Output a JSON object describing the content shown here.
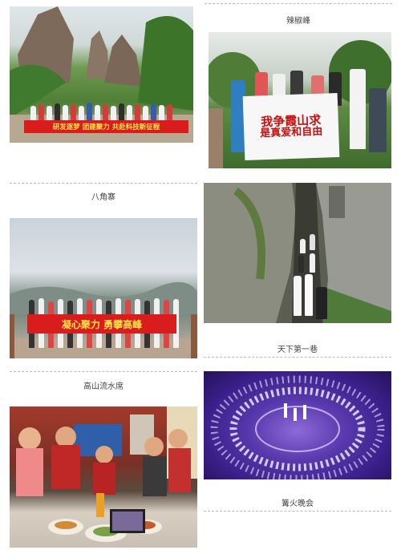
{
  "captions": {
    "lajiaofeng": "辣椒峰",
    "bajiaozhai": "八角寨",
    "tianxia_diyixiang": "天下第一巷",
    "gaoshan_liushuixi": "高山流水席",
    "gouhuo_wanhui": "篝火晚会"
  },
  "banners": {
    "group1": "研发逐梦  团建聚力  共赴科技新征程",
    "group3": "凝心聚力  勇攀高峰"
  },
  "sign": {
    "line1": "我争霞山求",
    "line2": "是真爱和自由"
  },
  "colors": {
    "banner_red": "#d91c1c",
    "banner_text": "#ffe44a",
    "caption_text": "#444444",
    "divider": "#b8b8b8",
    "stage_purple": "#3b1f8a"
  }
}
